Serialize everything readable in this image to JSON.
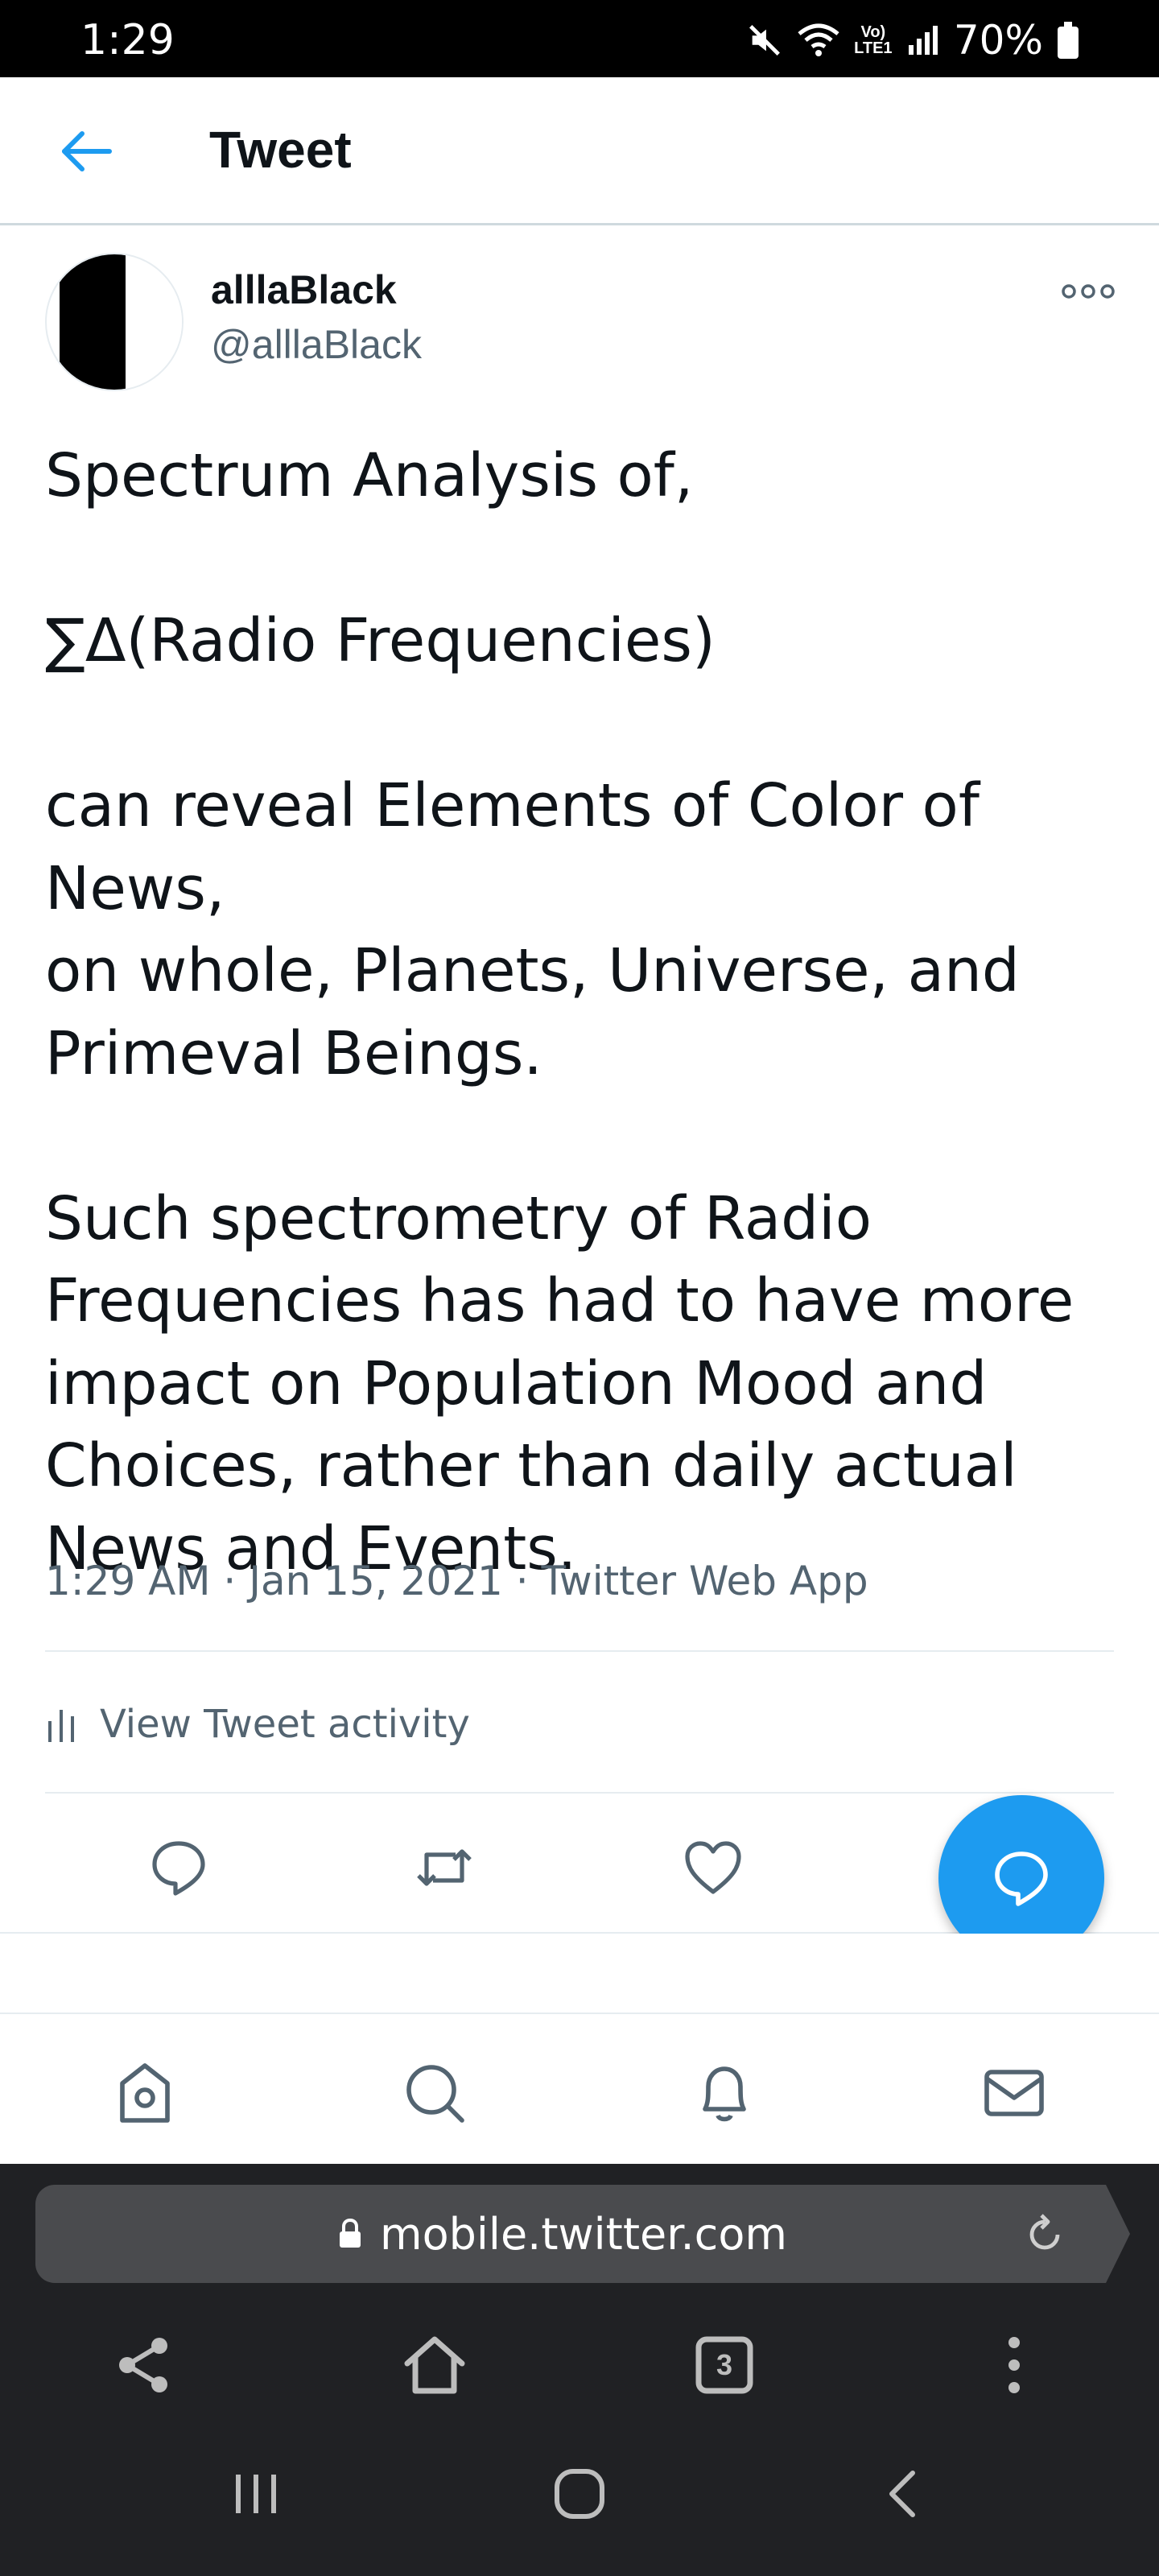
{
  "status_bar": {
    "time": "1:29",
    "network_label": "Vo) LTE1",
    "battery": "70%",
    "icons": [
      "mute-icon",
      "wifi-icon",
      "signal-icon",
      "battery-icon"
    ]
  },
  "header": {
    "title": "Tweet",
    "back_icon": "arrow-left-icon"
  },
  "tweet": {
    "display_name": "alllaBlack",
    "handle": "@alllaBlack",
    "text_lines": [
      "Spectrum Analysis of,",
      "",
      "∑Δ(Radio Frequencies)",
      "",
      "can reveal Elements of Color of News,",
      "on whole, Planets, Universe, and",
      "Primeval Beings.",
      "",
      "Such spectrometry of Radio",
      "Frequencies has had to have more",
      "impact on Population Mood and",
      "Choices, rather than daily actual",
      "News and Events."
    ],
    "timestamp": "1:29 AM · Jan 15, 2021",
    "source": "Twitter Web App",
    "activity_label": "View Tweet activity"
  },
  "actions": [
    "reply-icon",
    "retweet-icon",
    "like-icon"
  ],
  "bottom_nav": [
    "home-icon",
    "search-icon",
    "notifications-icon",
    "messages-icon"
  ],
  "browser": {
    "url": "mobile.twitter.com",
    "tab_count": "3"
  },
  "colors": {
    "accent": "#1d9bf0",
    "text": "#0f1419",
    "muted": "#536471",
    "divider": "#e6ecf0",
    "browser_bg": "#202124"
  }
}
